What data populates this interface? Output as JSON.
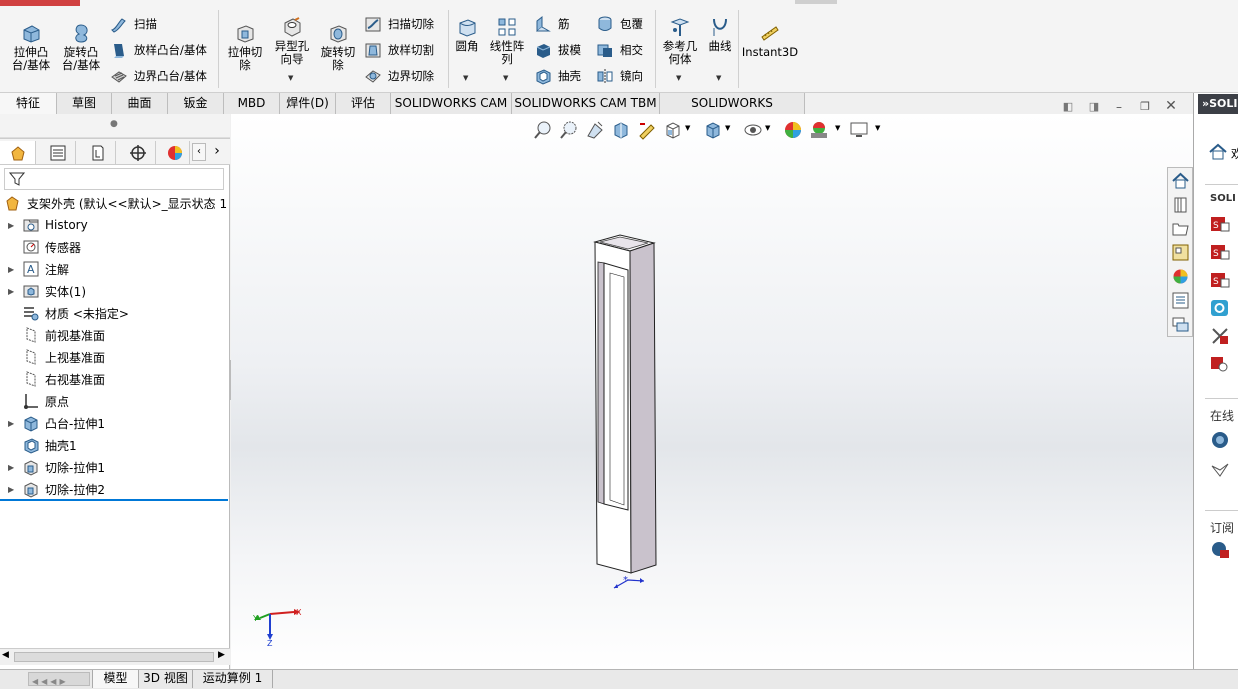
{
  "ribbon": {
    "extrude_boss": "拉伸凸\n台/基体",
    "revolve_boss": "旋转凸\n台/基体",
    "sweep": "扫描",
    "loft_boss": "放样凸台/基体",
    "boundary_boss": "边界凸台/基体",
    "extrude_cut": "拉伸切\n除",
    "hole_wizard": "异型孔\n向导",
    "revolve_cut": "旋转切\n除",
    "swept_cut": "扫描切除",
    "lofted_cut": "放样切割",
    "boundary_cut": "边界切除",
    "fillet": "圆角",
    "linear_pattern": "线性阵\n列",
    "rib": "筋",
    "draft": "拔模",
    "shell": "抽壳",
    "wrap": "包覆",
    "intersect": "相交",
    "mirror": "镜向",
    "ref_geometry": "参考几\n何体",
    "curves": "曲线",
    "instant3d": "Instant3D"
  },
  "tabs": [
    "特征",
    "草图",
    "曲面",
    "钣金",
    "MBD",
    "焊件(D)",
    "评估",
    "SOLIDWORKS CAM",
    "SOLIDWORKS CAM TBM",
    "SOLIDWORKS Inspection"
  ],
  "tree": {
    "root": "支架外壳  (默认<<默认>_显示状态 1",
    "items": [
      "History",
      "传感器",
      "注解",
      "实体(1)",
      "材质 <未指定>",
      "前视基准面",
      "上视基准面",
      "右视基准面",
      "原点",
      "凸台-拉伸1",
      "抽壳1",
      "切除-拉伸1",
      "切除-拉伸2"
    ]
  },
  "status_tabs": [
    "模型",
    "3D 视图",
    "运动算例 1"
  ],
  "right_panel": {
    "header": "SOLI",
    "section1": "SOLI",
    "section2": "在线",
    "section3": "订阅"
  },
  "triad": {
    "x": "X",
    "y": "Y",
    "z": "Z"
  },
  "colors": {
    "accent": "#0078d7",
    "part_face": "#ffffff",
    "part_side": "#c9c2cc"
  }
}
